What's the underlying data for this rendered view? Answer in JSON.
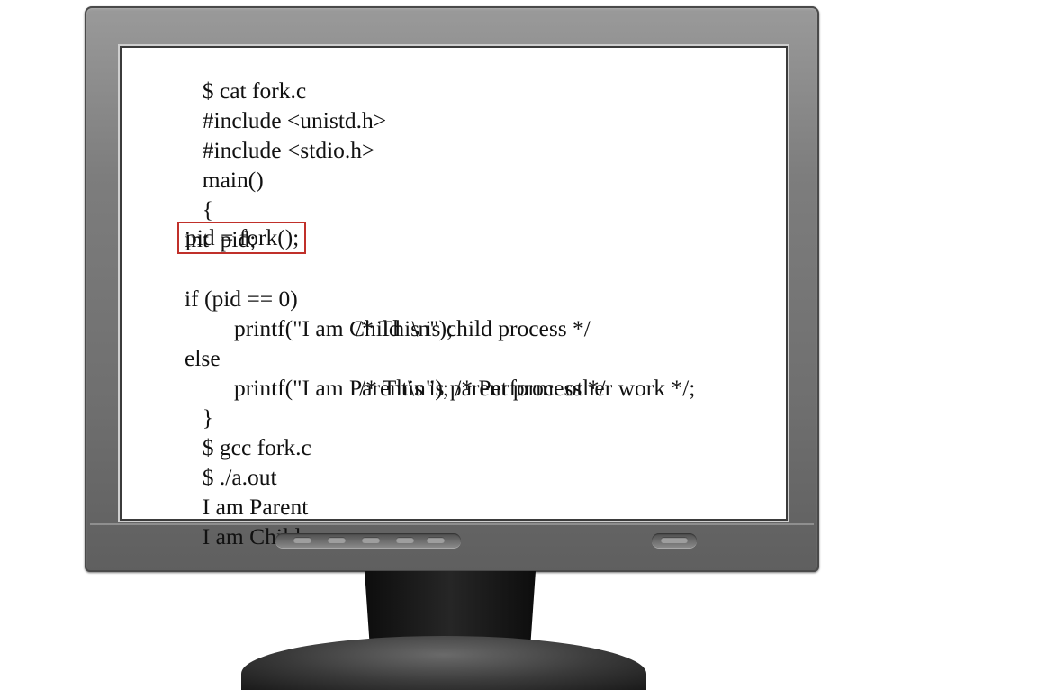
{
  "screen": {
    "lines": [
      {
        "id": "l1",
        "text": "$ cat fork.c"
      },
      {
        "id": "l2",
        "text": "#include <unistd.h>"
      },
      {
        "id": "l3",
        "text": "#include <stdio.h>"
      },
      {
        "id": "l4",
        "text": "main()"
      },
      {
        "id": "l5",
        "brace": "{",
        "text": "int  pid;"
      },
      {
        "id": "l6",
        "text": ""
      },
      {
        "id": "l7",
        "text": "pid = fork();",
        "highlighted": true
      },
      {
        "id": "l8",
        "text": "if (pid == 0)",
        "comment": "/* This is child process */"
      },
      {
        "id": "l9",
        "text": "printf(\"I am Child  \\n\");"
      },
      {
        "id": "l10",
        "text": "else",
        "comment": "/* This is parent process */"
      },
      {
        "id": "l11",
        "text": "printf(\"I am Parent\\n\"); /* Perform  other work */;"
      },
      {
        "id": "l12",
        "text": "}"
      },
      {
        "id": "l13",
        "text": "$ gcc fork.c"
      },
      {
        "id": "l14",
        "text": "$ ./a.out"
      },
      {
        "id": "l15",
        "text": "I am Parent"
      },
      {
        "id": "l16",
        "text": "I am Child"
      }
    ]
  },
  "colors": {
    "highlight_border": "#c0302a",
    "screen_background": "#ffffff",
    "text": "#111111",
    "bezel": "#7d7d7d"
  },
  "icons": {
    "control_buttons": "monitor-control-buttons",
    "power": "power-button"
  }
}
